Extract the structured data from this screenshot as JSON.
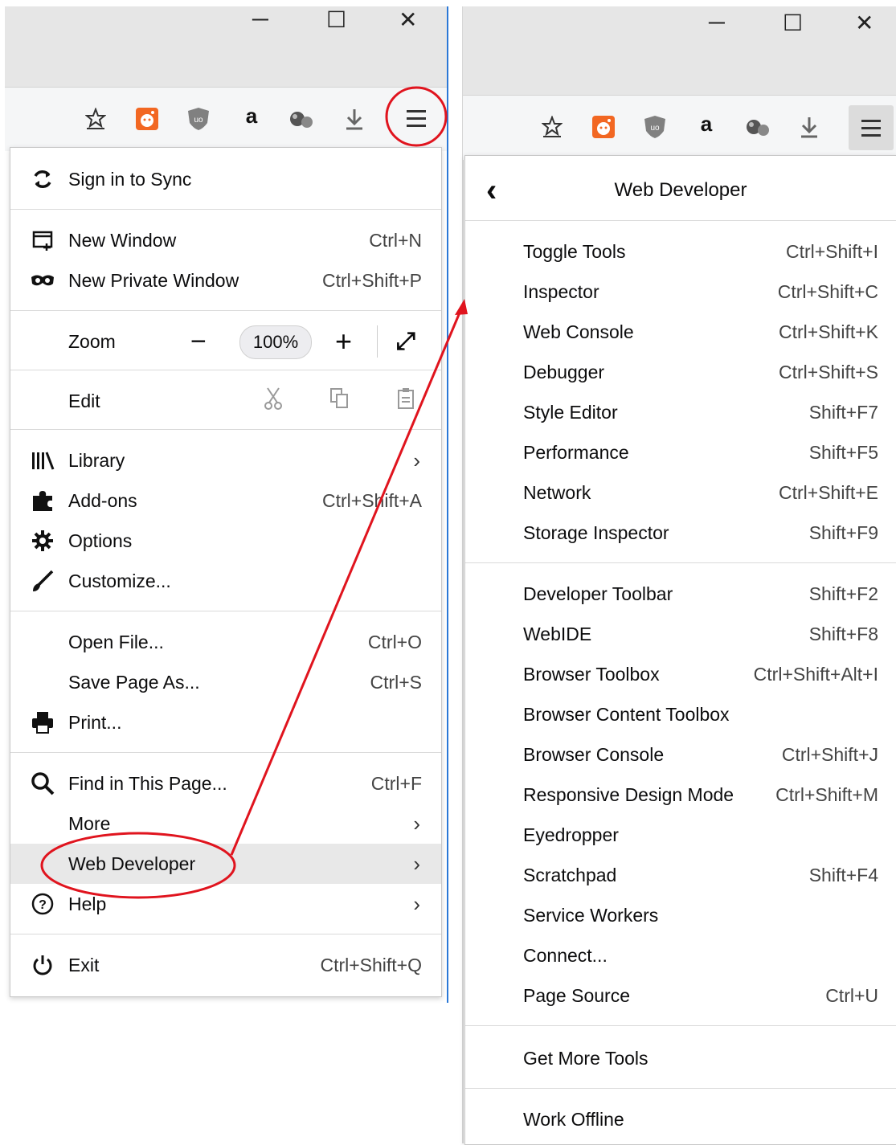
{
  "left_window": {
    "controls": {
      "minimize": "─",
      "maximize": "☐",
      "close": "✕"
    },
    "toolbar_icons": [
      "bookmark-star-icon",
      "reddit-icon",
      "ublock-icon",
      "amazon-icon",
      "extension-icon",
      "download-icon"
    ],
    "amazon_glyph": "a",
    "menu": {
      "sign_in": "Sign in to Sync",
      "new_window": {
        "label": "New Window",
        "shortcut": "Ctrl+N"
      },
      "new_private": {
        "label": "New Private Window",
        "shortcut": "Ctrl+Shift+P"
      },
      "zoom": {
        "label": "Zoom",
        "minus": "−",
        "value": "100%",
        "plus": "+",
        "fullscreen": "⤢"
      },
      "edit": {
        "label": "Edit"
      },
      "library": {
        "label": "Library",
        "chevron": "›"
      },
      "addons": {
        "label": "Add-ons",
        "shortcut": "Ctrl+Shift+A"
      },
      "options": {
        "label": "Options"
      },
      "customize": {
        "label": "Customize..."
      },
      "open_file": {
        "label": "Open File...",
        "shortcut": "Ctrl+O"
      },
      "save_page": {
        "label": "Save Page As...",
        "shortcut": "Ctrl+S"
      },
      "print": {
        "label": "Print..."
      },
      "find": {
        "label": "Find in This Page...",
        "shortcut": "Ctrl+F"
      },
      "more": {
        "label": "More",
        "chevron": "›"
      },
      "web_dev": {
        "label": "Web Developer",
        "chevron": "›"
      },
      "help": {
        "label": "Help",
        "chevron": "›"
      },
      "exit": {
        "label": "Exit",
        "shortcut": "Ctrl+Shift+Q"
      }
    }
  },
  "right_window": {
    "controls": {
      "minimize": "─",
      "maximize": "☐",
      "close": "✕"
    },
    "amazon_glyph": "a",
    "menu": {
      "back": "‹",
      "title": "Web Developer",
      "items_group1": [
        {
          "label": "Toggle Tools",
          "shortcut": "Ctrl+Shift+I"
        },
        {
          "label": "Inspector",
          "shortcut": "Ctrl+Shift+C"
        },
        {
          "label": "Web Console",
          "shortcut": "Ctrl+Shift+K"
        },
        {
          "label": "Debugger",
          "shortcut": "Ctrl+Shift+S"
        },
        {
          "label": "Style Editor",
          "shortcut": "Shift+F7"
        },
        {
          "label": "Performance",
          "shortcut": "Shift+F5"
        },
        {
          "label": "Network",
          "shortcut": "Ctrl+Shift+E"
        },
        {
          "label": "Storage Inspector",
          "shortcut": "Shift+F9"
        }
      ],
      "items_group2": [
        {
          "label": "Developer Toolbar",
          "shortcut": "Shift+F2"
        },
        {
          "label": "WebIDE",
          "shortcut": "Shift+F8"
        },
        {
          "label": "Browser Toolbox",
          "shortcut": "Ctrl+Shift+Alt+I"
        },
        {
          "label": "Browser Content Toolbox",
          "shortcut": ""
        },
        {
          "label": "Browser Console",
          "shortcut": "Ctrl+Shift+J"
        },
        {
          "label": "Responsive Design Mode",
          "shortcut": "Ctrl+Shift+M"
        },
        {
          "label": "Eyedropper",
          "shortcut": ""
        },
        {
          "label": "Scratchpad",
          "shortcut": "Shift+F4"
        },
        {
          "label": "Service Workers",
          "shortcut": ""
        },
        {
          "label": "Connect...",
          "shortcut": ""
        },
        {
          "label": "Page Source",
          "shortcut": "Ctrl+U"
        }
      ],
      "get_more_tools": "Get More Tools",
      "work_offline": "Work Offline"
    }
  },
  "annotation_color": "#e0141e"
}
